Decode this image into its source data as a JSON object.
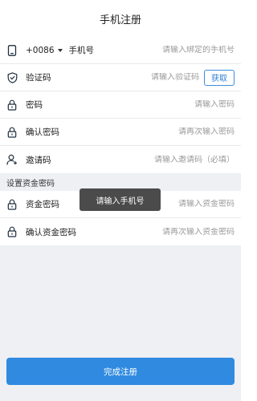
{
  "header": {
    "title": "手机注册"
  },
  "phone": {
    "country_code": "+0086",
    "label": "手机号",
    "placeholder": "请输入绑定的手机号",
    "icon": "phone-icon"
  },
  "captcha": {
    "label": "验证码",
    "placeholder": "请输入验证码",
    "button": "获取",
    "icon": "shield-icon"
  },
  "password": {
    "label": "密码",
    "placeholder": "请输入密码",
    "icon": "lock-icon"
  },
  "confirm_password": {
    "label": "确认密码",
    "placeholder": "请再次输入密码",
    "icon": "lock-icon"
  },
  "invite_code": {
    "label": "邀请码",
    "placeholder": "请输入邀请码（必填）",
    "icon": "user-add-icon"
  },
  "fund_section": {
    "title": "设置资金密码",
    "fund_password": {
      "label": "资金密码",
      "placeholder": "请输入资金密码",
      "icon": "lock-icon"
    },
    "confirm_fund_password": {
      "label": "确认资金密码",
      "placeholder": "请再次输入资金密码",
      "icon": "lock-icon"
    }
  },
  "toast": {
    "text": "请输入手机号"
  },
  "submit": {
    "label": "完成注册"
  },
  "colors": {
    "accent": "#2f8ae0",
    "background": "#eef0f4",
    "toast_bg": "#3c3c3c"
  }
}
